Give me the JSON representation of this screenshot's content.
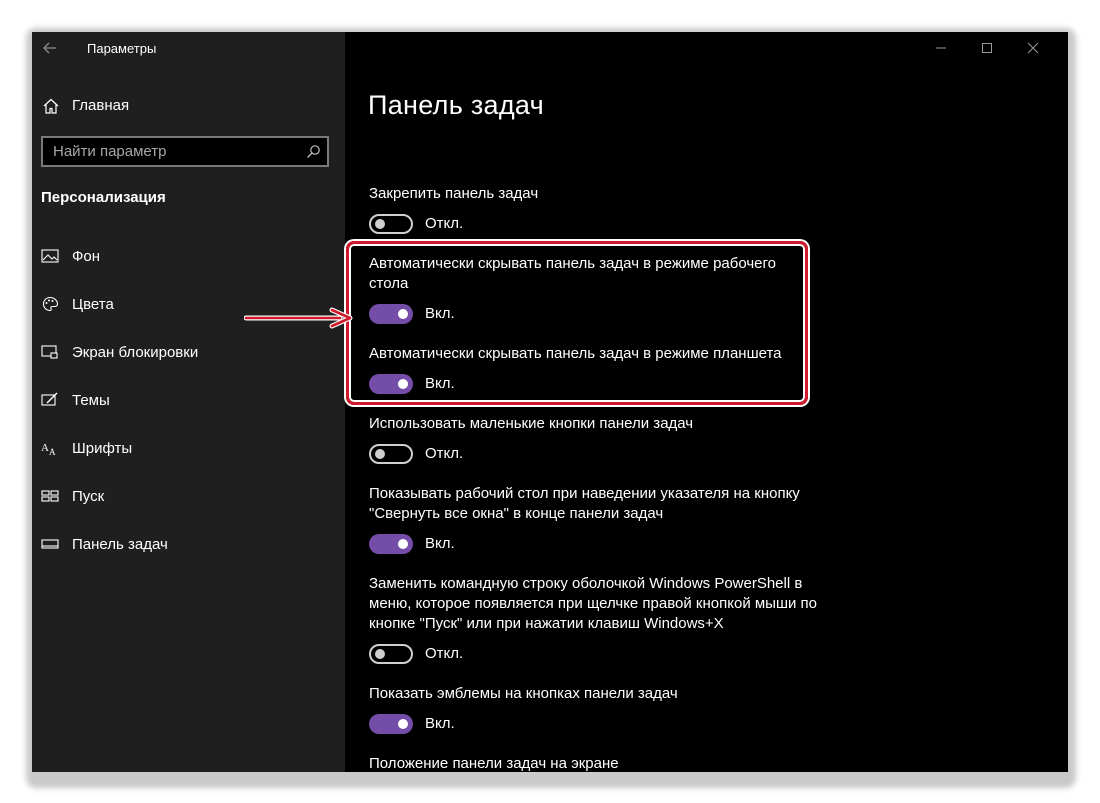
{
  "window": {
    "title": "Параметры"
  },
  "sidebar": {
    "home_label": "Главная",
    "search_placeholder": "Найти параметр",
    "section_title": "Персонализация",
    "items": [
      {
        "label": "Фон",
        "icon": "picture-icon"
      },
      {
        "label": "Цвета",
        "icon": "palette-icon"
      },
      {
        "label": "Экран блокировки",
        "icon": "lock-screen-icon"
      },
      {
        "label": "Темы",
        "icon": "themes-brush-icon"
      },
      {
        "label": "Шрифты",
        "icon": "fonts-icon"
      },
      {
        "label": "Пуск",
        "icon": "start-tiles-icon"
      },
      {
        "label": "Панель задач",
        "icon": "taskbar-icon"
      }
    ]
  },
  "main": {
    "page_title": "Панель задач",
    "settings": [
      {
        "label": "Закрепить панель задач",
        "state": "Откл.",
        "on": false
      },
      {
        "label": "Автоматически скрывать панель задач в режиме рабочего стола",
        "state": "Вкл.",
        "on": true
      },
      {
        "label": "Автоматически скрывать панель задач в режиме планшета",
        "state": "Вкл.",
        "on": true
      },
      {
        "label": "Использовать маленькие кнопки панели задач",
        "state": "Откл.",
        "on": false
      },
      {
        "label": "Показывать рабочий стол при наведении указателя на кнопку \"Свернуть все окна\" в конце панели задач",
        "state": "Вкл.",
        "on": true
      },
      {
        "label": "Заменить командную строку оболочкой Windows PowerShell в меню, которое появляется при щелчке правой кнопкой мыши по кнопке \"Пуск\" или при нажатии клавиш Windows+X",
        "state": "Откл.",
        "on": false
      },
      {
        "label": "Показать эмблемы на кнопках панели задач",
        "state": "Вкл.",
        "on": true
      }
    ],
    "next_section_heading": "Положение панели задач на экране"
  },
  "colors": {
    "accent": "#744da9",
    "highlight": "#d0192a",
    "sidebar_bg": "#1f1f1f",
    "main_bg": "#000000"
  }
}
